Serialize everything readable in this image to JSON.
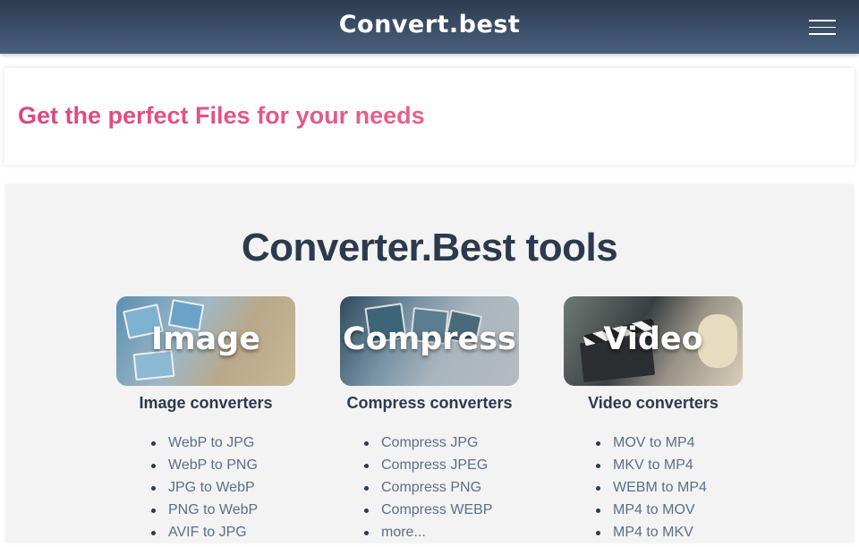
{
  "header": {
    "brand": "Convert.best",
    "menu_icon": "hamburger-menu-icon"
  },
  "hero": {
    "title": "Get the perfect Files for your needs"
  },
  "tools": {
    "title": "Converter.Best tools",
    "columns": [
      {
        "card_label": "Image",
        "heading": "Image converters",
        "links": [
          "WebP to JPG",
          "WebP to PNG",
          "JPG to WebP",
          "PNG to WebP",
          "AVIF to JPG"
        ]
      },
      {
        "card_label": "Compress",
        "heading": "Compress converters",
        "links": [
          "Compress JPG",
          "Compress JPEG",
          "Compress PNG",
          "Compress WEBP",
          "more..."
        ]
      },
      {
        "card_label": "Video",
        "heading": "Video converters",
        "links": [
          "MOV to MP4",
          "MKV to MP4",
          "WEBM to MP4",
          "MP4 to MOV",
          "MP4 to MKV"
        ]
      }
    ]
  },
  "colors": {
    "navbar": "#3a4a60",
    "hero_title": "#e0457f",
    "heading": "#2c3a4d",
    "link": "#5a6f88",
    "section_bg": "#f3f3f3"
  }
}
